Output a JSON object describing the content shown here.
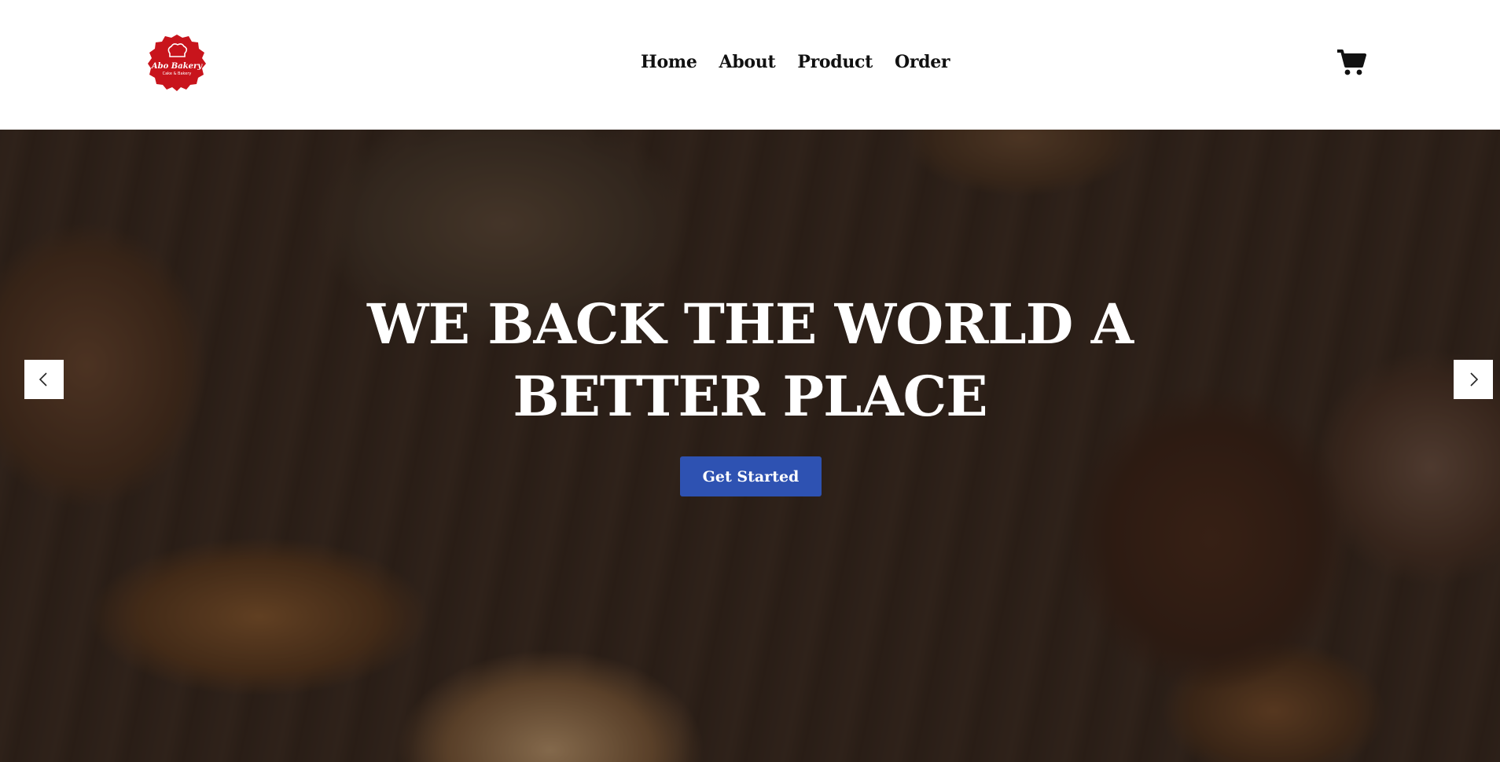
{
  "brand": {
    "name": "Abo Bakery",
    "tagline": "Cake & Bakery",
    "color": "#c8141c"
  },
  "nav": {
    "items": [
      {
        "label": "Home"
      },
      {
        "label": "About"
      },
      {
        "label": "Product"
      },
      {
        "label": "Order"
      }
    ],
    "cart_icon": "shopping-cart-icon"
  },
  "hero": {
    "title_line1": "WE BACK THE WORLD A",
    "title_line2": "BETTER PLACE",
    "cta_label": "Get Started",
    "cta_color": "#2e52b2",
    "prev_icon": "chevron-left-icon",
    "next_icon": "chevron-right-icon"
  }
}
